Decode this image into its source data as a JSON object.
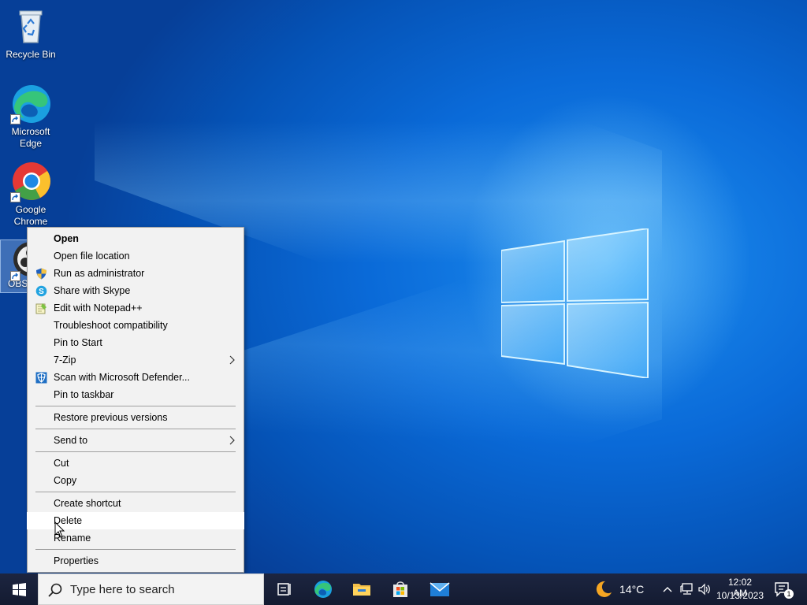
{
  "desktop": {
    "icons": [
      {
        "label": "Recycle Bin",
        "icon": "recycle-bin-icon"
      },
      {
        "label": "Microsoft Edge",
        "icon": "edge-icon"
      },
      {
        "label": "Google Chrome",
        "icon": "chrome-icon"
      },
      {
        "label": "OBS",
        "icon": "obs-icon"
      }
    ]
  },
  "context_menu": {
    "items": [
      {
        "label": "Open",
        "bold": true
      },
      {
        "label": "Open file location"
      },
      {
        "label": "Run as administrator",
        "icon": "uac-shield-icon"
      },
      {
        "label": "Share with Skype",
        "icon": "skype-icon"
      },
      {
        "label": "Edit with Notepad++",
        "icon": "notepadpp-icon"
      },
      {
        "label": "Troubleshoot compatibility"
      },
      {
        "label": "Pin to Start"
      },
      {
        "label": "7-Zip",
        "submenu": true
      },
      {
        "label": "Scan with Microsoft Defender...",
        "icon": "defender-icon"
      },
      {
        "label": "Pin to taskbar"
      },
      {
        "label": "Restore previous versions"
      },
      {
        "label": "Send to",
        "submenu": true
      },
      {
        "label": "Cut"
      },
      {
        "label": "Copy"
      },
      {
        "label": "Create shortcut"
      },
      {
        "label": "Delete",
        "hovered": true
      },
      {
        "label": "Rename"
      },
      {
        "label": "Properties"
      }
    ],
    "submenu_arrow": ">"
  },
  "taskbar": {
    "search_placeholder": "Type here to search",
    "apps": [
      "task-view-icon",
      "edge-icon",
      "file-explorer-icon",
      "microsoft-store-icon",
      "mail-icon"
    ],
    "weather_temp": "14°C",
    "clock_time": "12:02 AM",
    "clock_date": "10/13/2023",
    "notification_count": "1"
  },
  "colors": {
    "desktop_blue": "#0a6ad8",
    "taskbar": "#18213a",
    "menu_bg": "#f2f2f2",
    "menu_hover": "#ffffff"
  }
}
